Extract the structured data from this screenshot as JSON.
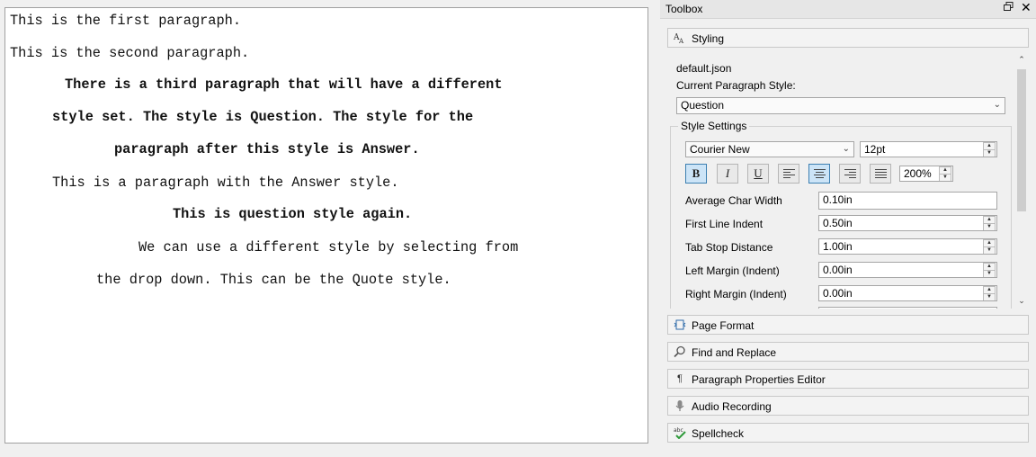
{
  "editor": {
    "paragraphs": [
      {
        "text": "This is the first paragraph.",
        "bold": false
      },
      {
        "text": "This is the second paragraph.",
        "bold": false
      },
      {
        "text": "There is a third paragraph that will have a different",
        "bold": true
      },
      {
        "text": "style set. The style is Question. The style for the",
        "bold": true
      },
      {
        "text": "paragraph after this style is Answer.",
        "bold": true
      },
      {
        "text": "This is a paragraph with the Answer style.",
        "bold": false
      },
      {
        "text": "This is question style again.",
        "bold": true
      },
      {
        "text": "We can use a different style by selecting from",
        "bold": false
      },
      {
        "text": "the drop down. This can be the Quote style.",
        "bold": false
      }
    ]
  },
  "toolbox": {
    "title": "Toolbox",
    "restore_icon": "restore-icon",
    "close_glyph": "✕",
    "sections": {
      "styling": {
        "label": "Styling",
        "icon": "font-size-icon"
      },
      "page_format": {
        "label": "Page Format",
        "icon": "page-format-icon"
      },
      "find_replace": {
        "label": "Find and Replace",
        "icon": "magnifier-icon"
      },
      "paragraph_props": {
        "label": "Paragraph Properties Editor",
        "icon": "pilcrow-icon"
      },
      "audio": {
        "label": "Audio Recording",
        "icon": "microphone-icon"
      },
      "spellcheck": {
        "label": "Spellcheck",
        "icon": "spellcheck-icon"
      }
    },
    "styling": {
      "file_name": "default.json",
      "current_style_label": "Current Paragraph Style:",
      "current_style_value": "Question",
      "style_settings_label": "Style Settings",
      "font_family": "Courier New",
      "font_size": "12pt",
      "format_buttons": {
        "bold": "B",
        "italic": "I",
        "underline": "U"
      },
      "line_spacing": "200%",
      "settings": [
        {
          "label": "Average Char Width",
          "value": "0.10in",
          "spinner": false
        },
        {
          "label": "First Line Indent",
          "value": "0.50in",
          "spinner": true
        },
        {
          "label": "Tab Stop Distance",
          "value": "1.00in",
          "spinner": true
        },
        {
          "label": "Left Margin (Indent)",
          "value": "0.00in",
          "spinner": true
        },
        {
          "label": "Right Margin (Indent)",
          "value": "0.00in",
          "spinner": true
        }
      ]
    }
  }
}
